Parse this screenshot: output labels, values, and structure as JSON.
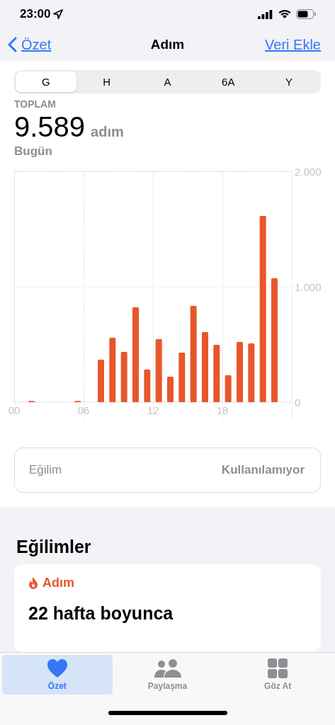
{
  "status_bar": {
    "time": "23:00"
  },
  "nav": {
    "back": "Özet",
    "title": "Adım",
    "action": "Veri Ekle"
  },
  "segments": [
    {
      "label": "G",
      "selected": true
    },
    {
      "label": "H",
      "selected": false
    },
    {
      "label": "A",
      "selected": false
    },
    {
      "label": "6A",
      "selected": false
    },
    {
      "label": "Y",
      "selected": false
    }
  ],
  "summary": {
    "caption": "TOPLAM",
    "value": "9.589",
    "unit": "adım",
    "date": "Bugün"
  },
  "chart_data": {
    "type": "bar",
    "x": [
      1.5,
      5.5,
      7.5,
      8.5,
      9.5,
      10.5,
      11.5,
      12.5,
      13.5,
      14.5,
      15.5,
      16.5,
      17.5,
      18.5,
      19.5,
      20.5,
      21.5,
      22.5
    ],
    "xlim": [
      0,
      24
    ],
    "series": [
      {
        "color": "#e8572a",
        "values": [
          10,
          10,
          368,
          558,
          436,
          822,
          282,
          546,
          221,
          429,
          834,
          607,
          497,
          233,
          521,
          509,
          1613,
          1074
        ]
      }
    ],
    "grid": true,
    "ylim": [
      0,
      2000
    ],
    "yticks": [
      {
        "value": 0,
        "label": "0"
      },
      {
        "value": 1000,
        "label": "1.000"
      },
      {
        "value": 2000,
        "label": "2.000"
      }
    ],
    "xticks": [
      {
        "value": 0,
        "label": "00"
      },
      {
        "value": 6,
        "label": "06"
      },
      {
        "value": 12,
        "label": "12"
      },
      {
        "value": 18,
        "label": "18"
      }
    ]
  },
  "trend_row": {
    "label": "Eğilim",
    "value": "Kullanılamıyor"
  },
  "trends": {
    "heading": "Eğilimler",
    "card": {
      "category": "Adım",
      "text": "22 hafta boyunca"
    }
  },
  "tab_bar": [
    {
      "label": "Özet",
      "kind": "heart",
      "selected": true
    },
    {
      "label": "Paylaşma",
      "kind": "people",
      "selected": false
    },
    {
      "label": "Göz At",
      "kind": "grid",
      "selected": false
    }
  ]
}
